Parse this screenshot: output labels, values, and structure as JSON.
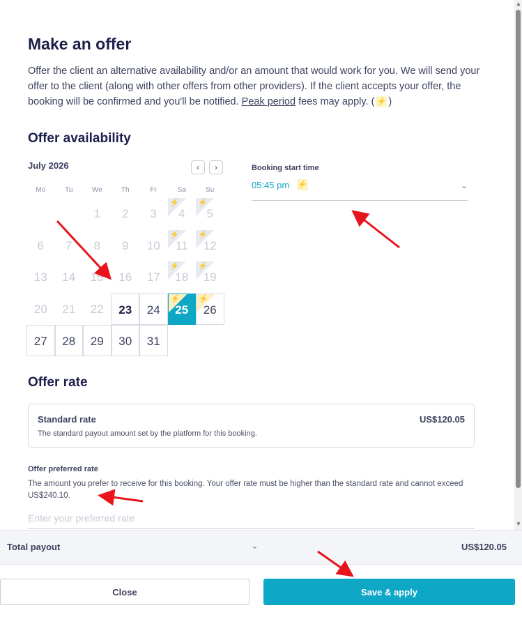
{
  "title": "Make an offer",
  "intro": {
    "text_before": "Offer the client an alternative availability and/or an amount that would work for you. We will send your offer to the client (along with other offers from other providers). If the client accepts your offer, the booking will be confirmed and you'll be notified.",
    "link": "Peak period",
    "text_after": "fees may apply. (",
    "close_paren": ")"
  },
  "availability": {
    "heading": "Offer availability",
    "month": "July 2026",
    "prev_label": "‹",
    "next_label": "›",
    "weekdays": [
      "Mo",
      "Tu",
      "We",
      "Th",
      "Fr",
      "Sa",
      "Su"
    ],
    "weeks": [
      [
        null,
        null,
        {
          "d": "1"
        },
        {
          "d": "2"
        },
        {
          "d": "3"
        },
        {
          "d": "4",
          "peak": "grey"
        },
        {
          "d": "5",
          "peak": "grey"
        }
      ],
      [
        {
          "d": "6"
        },
        {
          "d": "7"
        },
        {
          "d": "8"
        },
        {
          "d": "9"
        },
        {
          "d": "10"
        },
        {
          "d": "11",
          "peak": "grey"
        },
        {
          "d": "12",
          "peak": "grey"
        }
      ],
      [
        {
          "d": "13"
        },
        {
          "d": "14"
        },
        {
          "d": "15"
        },
        {
          "d": "16"
        },
        {
          "d": "17"
        },
        {
          "d": "18",
          "peak": "grey"
        },
        {
          "d": "19",
          "peak": "grey"
        }
      ],
      [
        {
          "d": "20"
        },
        {
          "d": "21"
        },
        {
          "d": "22"
        },
        {
          "d": "23",
          "avail": true,
          "bold": true
        },
        {
          "d": "24",
          "avail": true
        },
        {
          "d": "25",
          "avail": true,
          "selected": true,
          "peak": "gold"
        },
        {
          "d": "26",
          "avail": true,
          "peak": "gold"
        }
      ],
      [
        {
          "d": "27",
          "avail": true
        },
        {
          "d": "28",
          "avail": true
        },
        {
          "d": "29",
          "avail": true
        },
        {
          "d": "30",
          "avail": true
        },
        {
          "d": "31",
          "avail": true
        },
        null,
        null
      ]
    ],
    "time_label": "Booking start time",
    "time_value": "05:45 pm"
  },
  "rate": {
    "heading": "Offer rate",
    "standard_title": "Standard rate",
    "standard_amount": "US$120.05",
    "standard_desc": "The standard payout amount set by the platform for this booking.",
    "preferred_label": "Offer preferred rate",
    "preferred_desc": "The amount you prefer to receive for this booking. Your offer rate must be higher than the standard rate and cannot exceed US$240.10.",
    "preferred_placeholder": "Enter your preferred rate"
  },
  "footer": {
    "total_label": "Total payout",
    "total_amount": "US$120.05",
    "close_label": "Close",
    "save_label": "Save & apply"
  },
  "colors": {
    "accent": "#0fa7c6",
    "heading": "#1c1f4a",
    "annotation_arrow": "#e8141b"
  }
}
